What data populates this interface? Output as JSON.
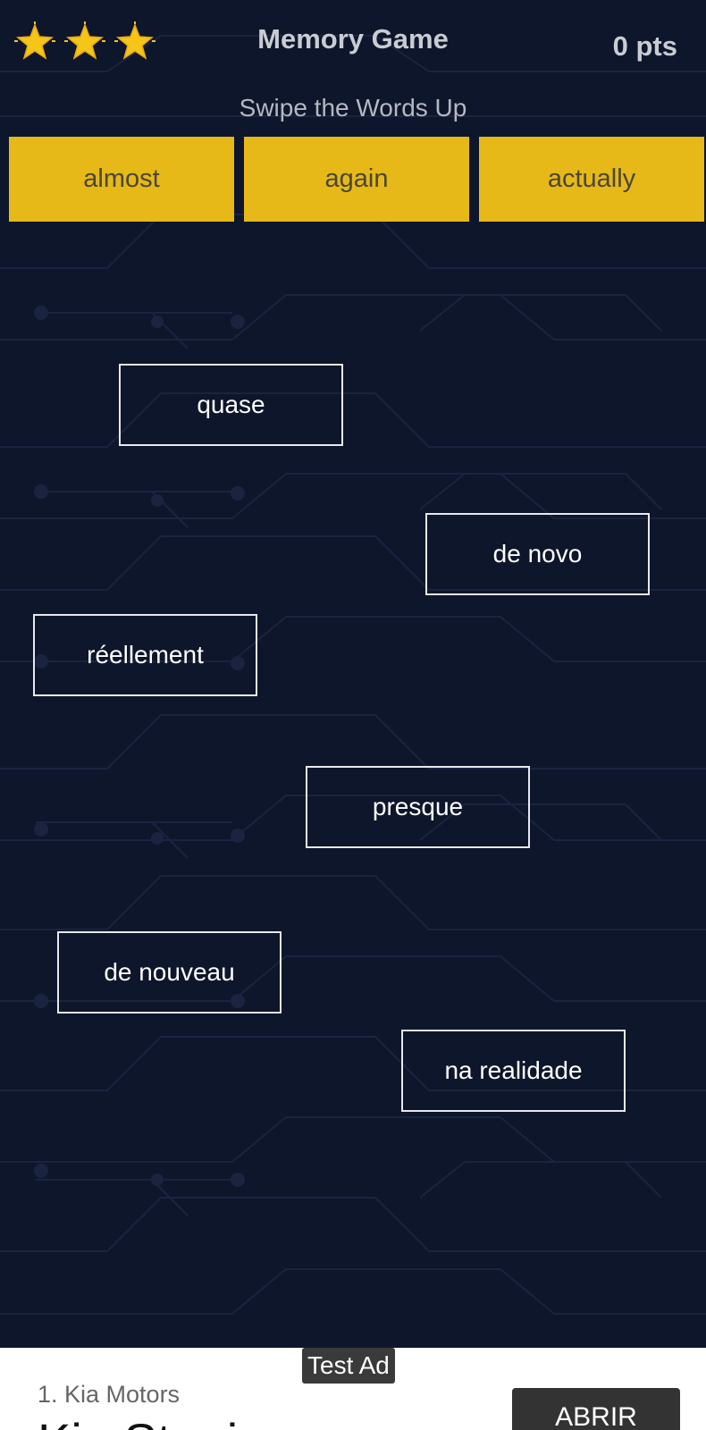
{
  "header": {
    "title": "Memory Game",
    "score": "0 pts",
    "stars_icon": "star-icon",
    "star_count": 3
  },
  "instruction": "Swipe the Words Up",
  "targets": [
    {
      "label": "almost"
    },
    {
      "label": "again"
    },
    {
      "label": "actually"
    }
  ],
  "cards": [
    {
      "label": "quase"
    },
    {
      "label": "de novo"
    },
    {
      "label": "réellement"
    },
    {
      "label": "presque"
    },
    {
      "label": "de nouveau"
    },
    {
      "label": "na realidade"
    }
  ],
  "ad": {
    "badge": "Test Ad",
    "advertiser": "1. Kia Motors",
    "headline": "Kia Stonic",
    "cta": "ABRIR"
  },
  "colors": {
    "background": "#0e162b",
    "target_fill": "#e6b918",
    "card_border": "#e8e9ee",
    "star": "#f5c518"
  }
}
